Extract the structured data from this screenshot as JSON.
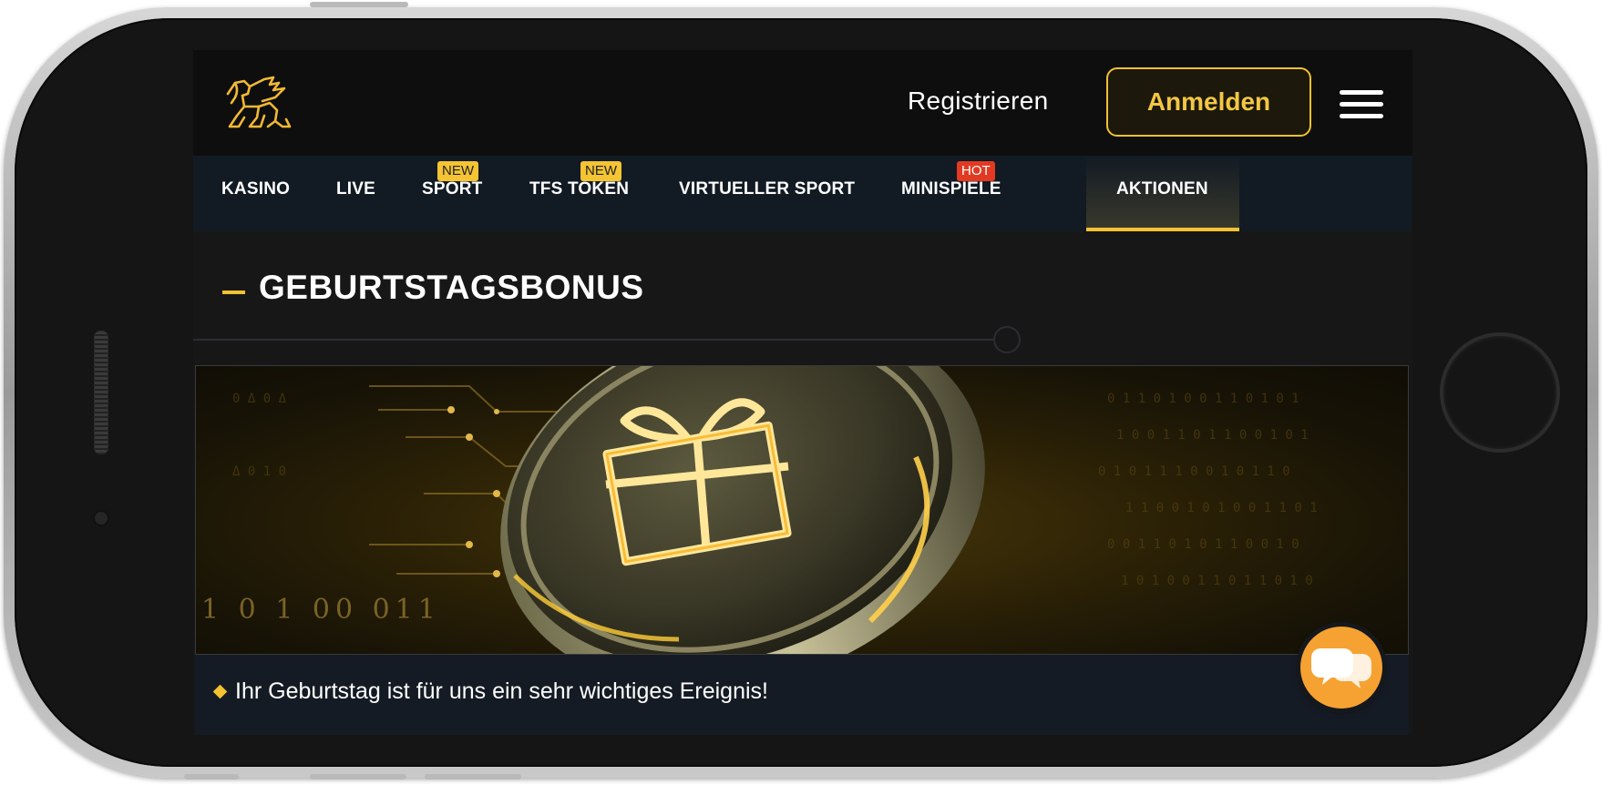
{
  "header": {
    "register_label": "Registrieren",
    "login_label": "Anmelden",
    "logo_icon": "lion-logo-icon",
    "menu_icon": "hamburger-menu-icon"
  },
  "nav": {
    "items": [
      {
        "label": "KASINO",
        "badge": ""
      },
      {
        "label": "LIVE",
        "badge": ""
      },
      {
        "label": "SPORT",
        "badge": "NEW"
      },
      {
        "label": "TFS TOKEN",
        "badge": "NEW"
      },
      {
        "label": "VIRTUELLER SPORT",
        "badge": ""
      },
      {
        "label": "MINISPIELE",
        "badge": "HOT"
      },
      {
        "label": "AKTIONEN",
        "badge": "",
        "active": true
      }
    ]
  },
  "page": {
    "title": "GEBURTSTAGSBONUS"
  },
  "banner": {
    "binary_text": "1 0 1  00  011",
    "image_icon": "gift-coin-icon"
  },
  "caption": {
    "text": "Ihr Geburtstag ist für uns ein sehr wichtiges Ereignis!"
  },
  "chat": {
    "icon": "chat-bubbles-icon"
  },
  "colors": {
    "accent": "#f3c233",
    "hot_badge": "#e23a22",
    "chat_button": "#f6a232",
    "nav_background": "#121a23",
    "header_background": "#0e0e0e"
  }
}
